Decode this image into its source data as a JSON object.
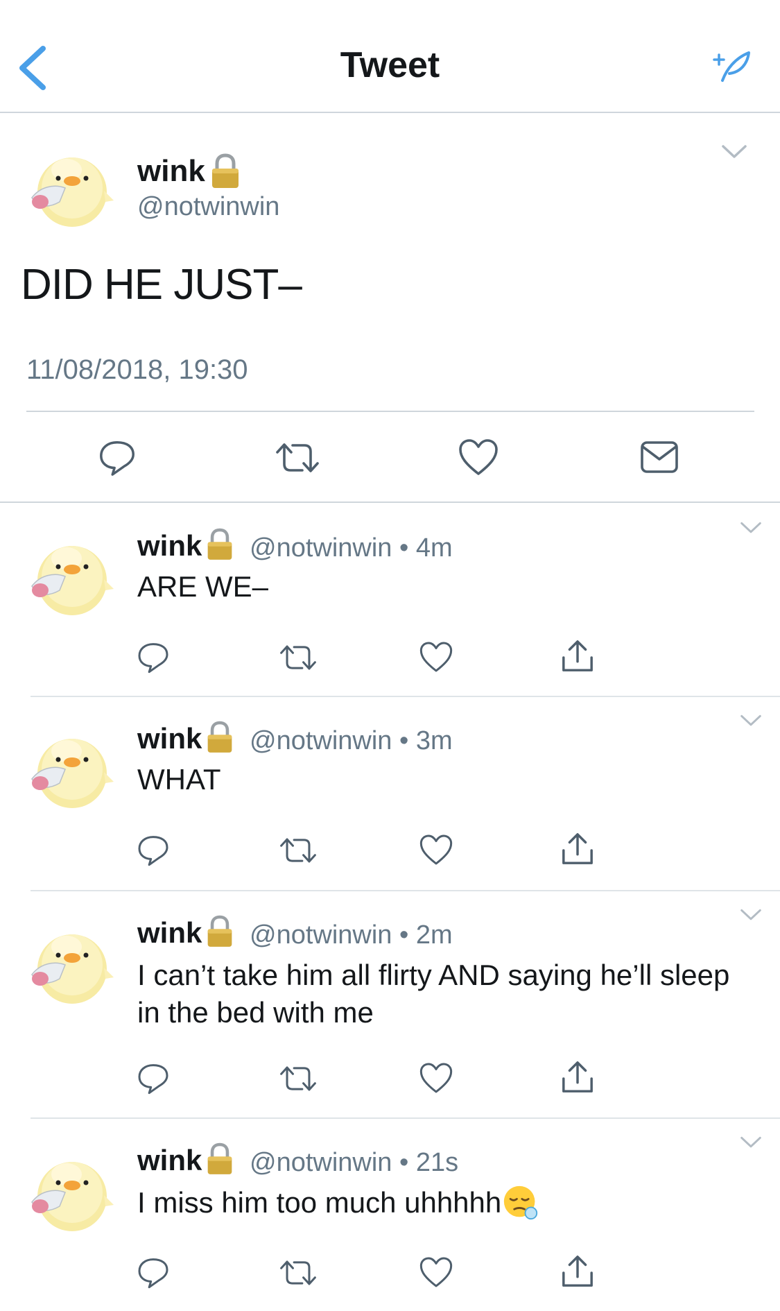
{
  "header": {
    "title": "Tweet",
    "back_icon": "chevron-left-icon",
    "compose_icon": "feather-compose-icon",
    "accent": "#4a9fe8"
  },
  "main_tweet": {
    "name": "wink",
    "handle": "@notwinwin",
    "text": "DID HE JUST–",
    "timestamp": "11/08/2018, 19:30"
  },
  "replies": [
    {
      "name": "wink",
      "meta": "@notwinwin • 4m",
      "text": "ARE WE–"
    },
    {
      "name": "wink",
      "meta": "@notwinwin • 3m",
      "text": "WHAT"
    },
    {
      "name": "wink",
      "meta": "@notwinwin • 2m",
      "text": "I can’t take him all flirty AND saying he’ll sleep in the bed with me"
    },
    {
      "name": "wink",
      "meta": "@notwinwin • 21s",
      "text": "I miss him too much uhhhhh"
    }
  ],
  "colors": {
    "text": "#14171a",
    "secondary": "#657786",
    "icon": "#4e5e6c",
    "divider": "#cfd6dc"
  }
}
